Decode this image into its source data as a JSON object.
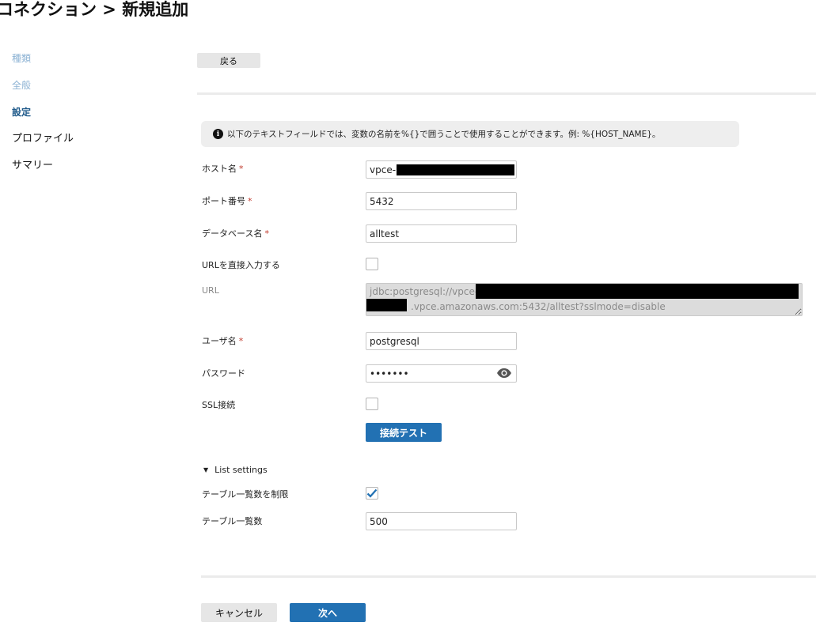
{
  "page": {
    "title": "コネクション > 新規追加"
  },
  "sidebar": {
    "items": [
      {
        "label": "種類"
      },
      {
        "label": "全般"
      },
      {
        "label": "設定"
      },
      {
        "label": "プロファイル"
      },
      {
        "label": "サマリー"
      }
    ]
  },
  "buttons": {
    "back": "戻る",
    "test": "接続テスト",
    "cancel": "キャンセル",
    "next": "次へ"
  },
  "info": {
    "icon": "info-circle-icon",
    "text": "以下のテキストフィールドでは、変数の名前を%{}で囲うことで使用することができます。例: %{HOST_NAME}。"
  },
  "form": {
    "required_mark": "*",
    "host": {
      "label": "ホスト名",
      "value": "vpce-"
    },
    "port": {
      "label": "ポート番号",
      "value": "5432"
    },
    "database": {
      "label": "データベース名",
      "value": "alltest"
    },
    "direct_url": {
      "label": "URLを直接入力する",
      "checked": false
    },
    "url": {
      "label": "URL",
      "line1": "jdbc:postgresql://vpce-",
      "line2": ".vpce.amazonaws.com:5432/alltest?sslmode=disable"
    },
    "user": {
      "label": "ユーザ名",
      "value": "postgresql"
    },
    "password": {
      "label": "パスワード",
      "value": "•••••••",
      "toggle_icon": "eye-icon"
    },
    "ssl": {
      "label": "SSL接続",
      "checked": false
    }
  },
  "list_settings": {
    "toggle": "List settings",
    "limit": {
      "label": "テーブル一覧数を制限",
      "checked": true
    },
    "count": {
      "label": "テーブル一覧数",
      "value": "500"
    }
  },
  "colors": {
    "primary": "#2271b3",
    "sidebar_done": "#8db3d4",
    "sidebar_active": "#1f5a8a",
    "required": "#c0392b"
  }
}
